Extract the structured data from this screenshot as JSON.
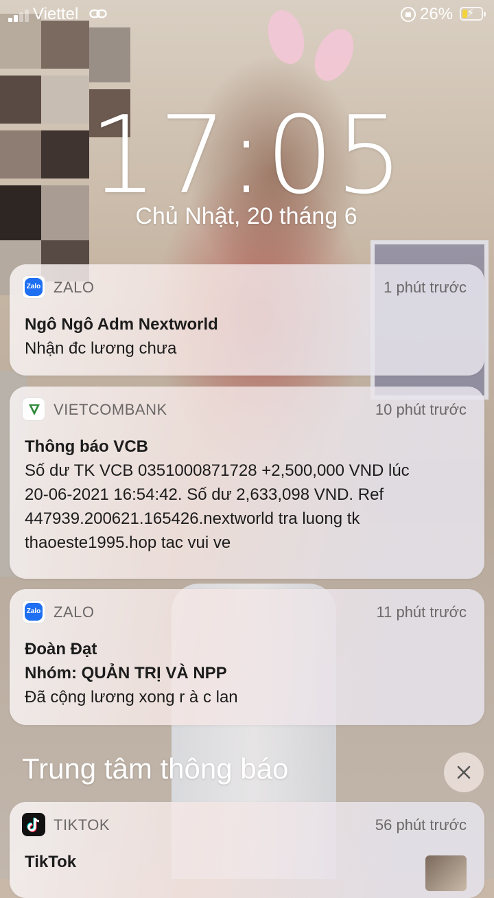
{
  "status_bar": {
    "carrier": "Viettel",
    "battery_percent": "26%",
    "battery_level": 0.26,
    "charging": true
  },
  "lock_screen": {
    "time": "17:05",
    "date": "Chủ Nhật, 20 tháng 6"
  },
  "notifications": [
    {
      "app": "ZALO",
      "icon": "zalo-icon",
      "time": "1 phút trước",
      "title": "Ngô Ngô Adm Nextworld",
      "subtitle": "",
      "body": "Nhận đc lương chưa"
    },
    {
      "app": "VIETCOMBANK",
      "icon": "vietcombank-icon",
      "time": "10 phút trước",
      "title": "Thông báo VCB",
      "body_lines": [
        "Số dư TK VCB 0351000871728 +2,500,000 VND lúc",
        "20-06-2021 16:54:42. Số dư 2,633,098 VND. Ref",
        "447939.200621.165426.nextworld tra luong tk",
        "thaoeste1995.hop tac vui ve"
      ]
    },
    {
      "app": "ZALO",
      "icon": "zalo-icon",
      "time": "11 phút trước",
      "title": "Đoàn Đạt",
      "subtitle": "Nhóm: QUẢN TRỊ VÀ NPP",
      "body": "Đã cộng lương xong r à c lan"
    }
  ],
  "notification_center": {
    "title": "Trung tâm thông báo",
    "clear_icon": "close-icon",
    "items": [
      {
        "app": "TIKTOK",
        "icon": "tiktok-icon",
        "time": "56 phút trước",
        "title": "TikTok"
      }
    ]
  },
  "zalo_icon_text": "Zalo"
}
